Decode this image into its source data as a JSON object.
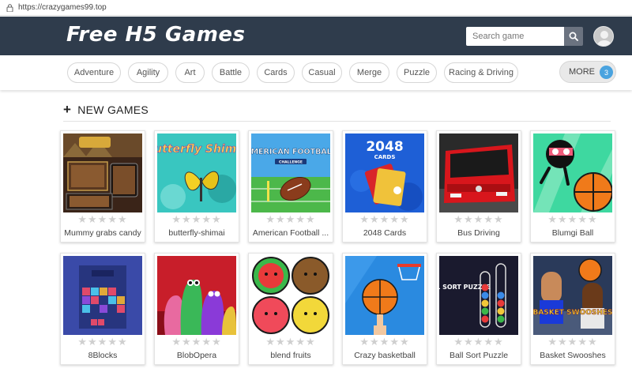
{
  "browser": {
    "url": "https://crazygames99.top"
  },
  "header": {
    "logo_text": "Free H5 Games",
    "search_placeholder": "Search game"
  },
  "categories": [
    "Adventure",
    "Agility",
    "Art",
    "Battle",
    "Cards",
    "Casual",
    "Merge",
    "Puzzle",
    "Racing & Driving"
  ],
  "more": {
    "label": "MORE",
    "badge": "3"
  },
  "section": {
    "title": "NEW GAMES"
  },
  "games": [
    {
      "name": "Mummy grabs candy",
      "rating_stars": 0
    },
    {
      "name": "butterfly-shimai",
      "rating_stars": 0,
      "thumb_title": "Butterfly Shimai"
    },
    {
      "name": "American Football ...",
      "rating_stars": 0,
      "thumb_title": "AMERICAN FOOTBALL",
      "thumb_sub": "CHALLENGE"
    },
    {
      "name": "2048 Cards",
      "rating_stars": 0,
      "thumb_title": "2048",
      "thumb_sub": "CARDS"
    },
    {
      "name": "Bus Driving",
      "rating_stars": 0
    },
    {
      "name": "Blumgi Ball",
      "rating_stars": 0
    },
    {
      "name": "8Blocks",
      "rating_stars": 0
    },
    {
      "name": "BlobOpera",
      "rating_stars": 0
    },
    {
      "name": "blend fruits",
      "rating_stars": 0
    },
    {
      "name": "Crazy basketball",
      "rating_stars": 0
    },
    {
      "name": "Ball Sort Puzzle",
      "rating_stars": 0,
      "thumb_title": "BALL SORT PUZZLE"
    },
    {
      "name": "Basket Swooshes",
      "rating_stars": 0,
      "thumb_title": "BASKET SWOOSHES"
    }
  ],
  "colors": {
    "header_bg": "#2f3c4c",
    "badge": "#4aa3df",
    "star_empty": "#cfcfcf"
  }
}
